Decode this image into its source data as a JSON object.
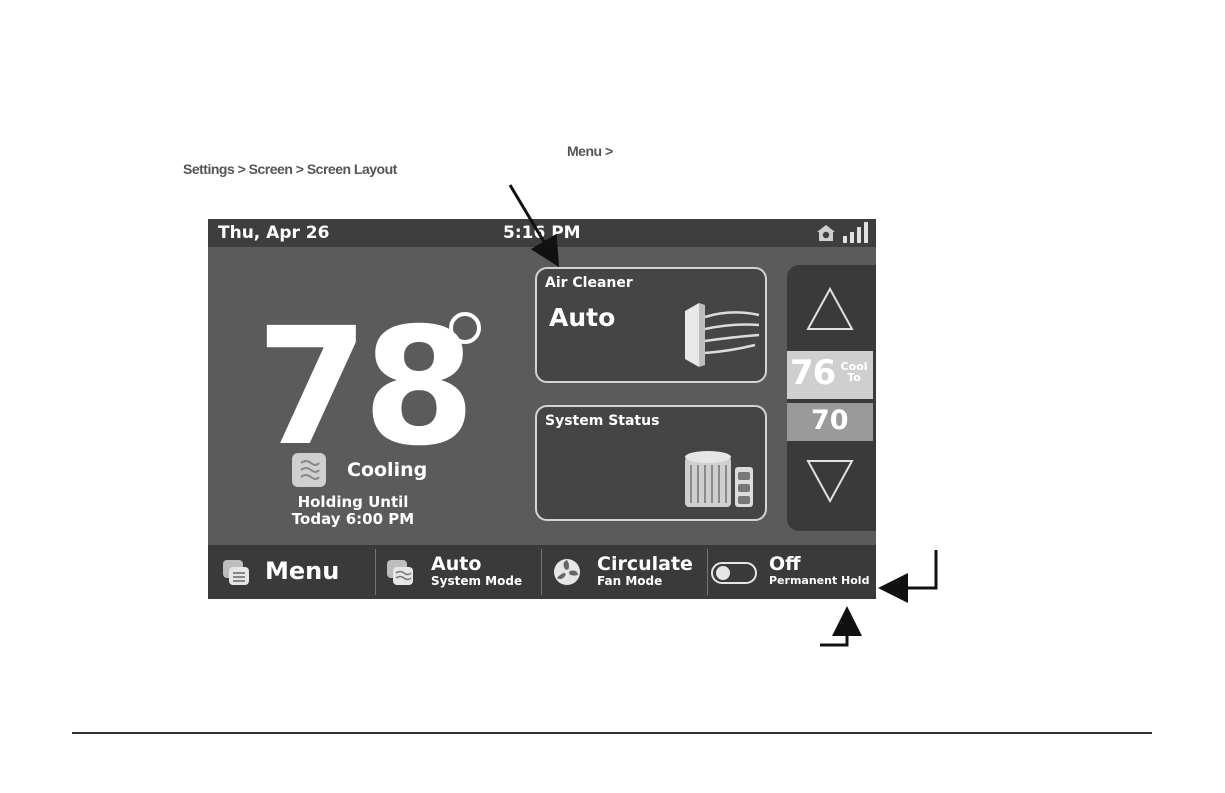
{
  "annotations": {
    "line1": "Menu >",
    "line2": "Settings > Screen > Screen Layout"
  },
  "statusbar": {
    "date": "Thu, Apr 26",
    "time": "5:16 PM",
    "icons": [
      "home-icon",
      "signal-icon"
    ]
  },
  "main": {
    "current_temp": "78",
    "status_label": "Cooling",
    "hold_line1": "Holding Until",
    "hold_line2": "Today 6:00 PM"
  },
  "cards": {
    "air_cleaner": {
      "title": "Air Cleaner",
      "value": "Auto",
      "icon": "air-cleaner-icon"
    },
    "system_status": {
      "title": "System Status",
      "icon": "condenser-unit-icon"
    }
  },
  "setpoints": {
    "cool_value": "76",
    "cool_label_1": "Cool",
    "cool_label_2": "To",
    "heat_value": "70"
  },
  "bottombar": {
    "menu_label": "Menu",
    "system_mode_value": "Auto",
    "system_mode_label": "System Mode",
    "fan_mode_value": "Circulate",
    "fan_mode_label": "Fan Mode",
    "hold_value": "Off",
    "hold_label": "Permanent Hold"
  },
  "colors": {
    "screen_bg": "#5b5b5b",
    "bar_bg": "#3a3a3a",
    "cool_setpoint": "#cfcfcf",
    "heat_setpoint": "#9a9a9a",
    "text": "#ffffff"
  }
}
